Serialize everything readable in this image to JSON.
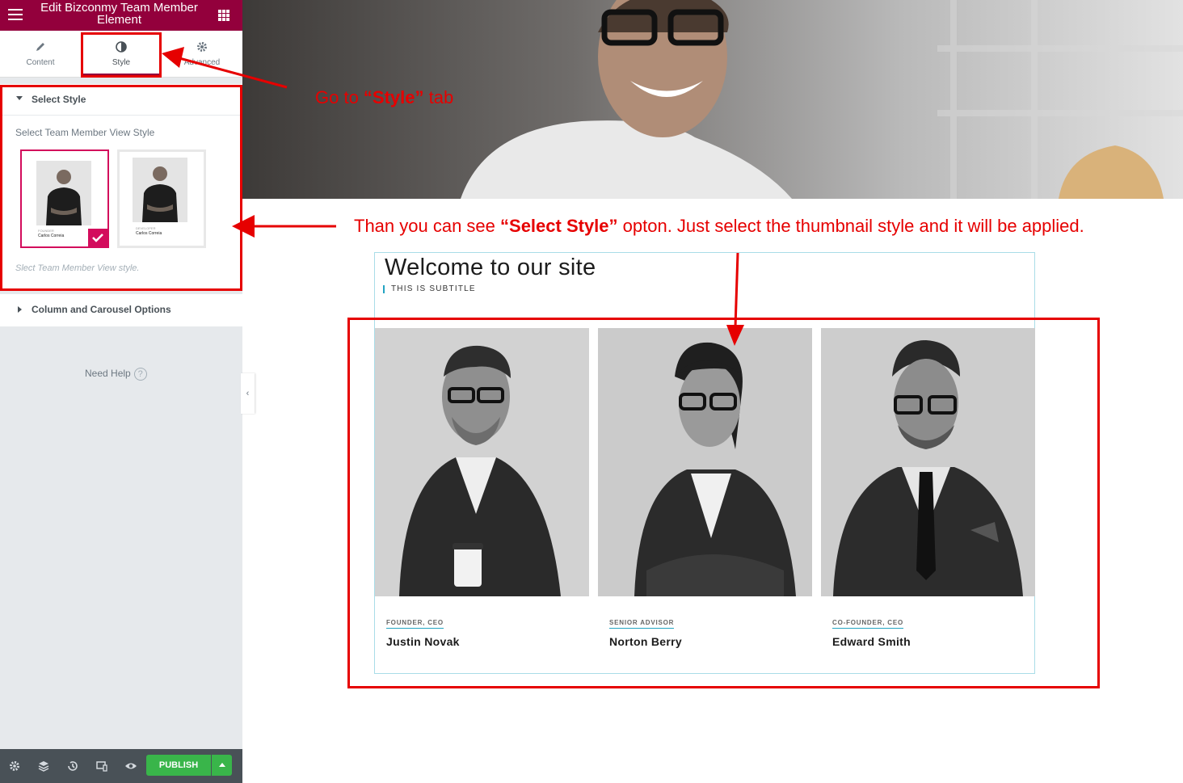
{
  "panel": {
    "title": "Edit Bizconmy Team Member Element",
    "tabs": [
      {
        "label": "Content",
        "icon": "pencil-icon"
      },
      {
        "label": "Style",
        "icon": "half-circle-icon"
      },
      {
        "label": "Advanced",
        "icon": "gear-icon"
      }
    ],
    "active_tab": "Style",
    "sections": {
      "select_style": {
        "heading": "Select Style",
        "control_label": "Select Team Member View Style",
        "thumbnails": [
          {
            "caption_role": "FOUNDER",
            "caption_name": "Carlos Correia",
            "selected": true
          },
          {
            "caption_role": "DEVELOPER",
            "caption_name": "Carlos Correia",
            "selected": false
          }
        ],
        "description": "Slect Team Member View style."
      },
      "column_carousel": {
        "heading": "Column and Carousel Options"
      }
    },
    "help": {
      "label": "Need Help",
      "icon": "question-circle-icon"
    },
    "footer": {
      "icons": [
        "settings-icon",
        "layers-icon",
        "history-icon",
        "responsive-icon",
        "eye-icon"
      ],
      "publish_label": "PUBLISH"
    },
    "accent_color": "#93003c"
  },
  "preview": {
    "title": "Welcome to our site",
    "subtitle": "THIS IS SUBTITLE",
    "members": [
      {
        "role": "FOUNDER, CEO",
        "name": "Justin Novak"
      },
      {
        "role": "SENIOR ADVISOR",
        "name": "Norton Berry"
      },
      {
        "role": "CO-FOUNDER, CEO",
        "name": "Edward Smith"
      }
    ]
  },
  "annotations": {
    "style_tab_note": {
      "prefix": "Go  to ",
      "bold": "“Style”",
      "suffix": " tab"
    },
    "select_style_note": {
      "prefix": "Than you  can see ",
      "bold": "“Select Style”",
      "suffix": " opton. Just select the thumbnail style and it will be applied."
    },
    "color": "#e60000"
  }
}
